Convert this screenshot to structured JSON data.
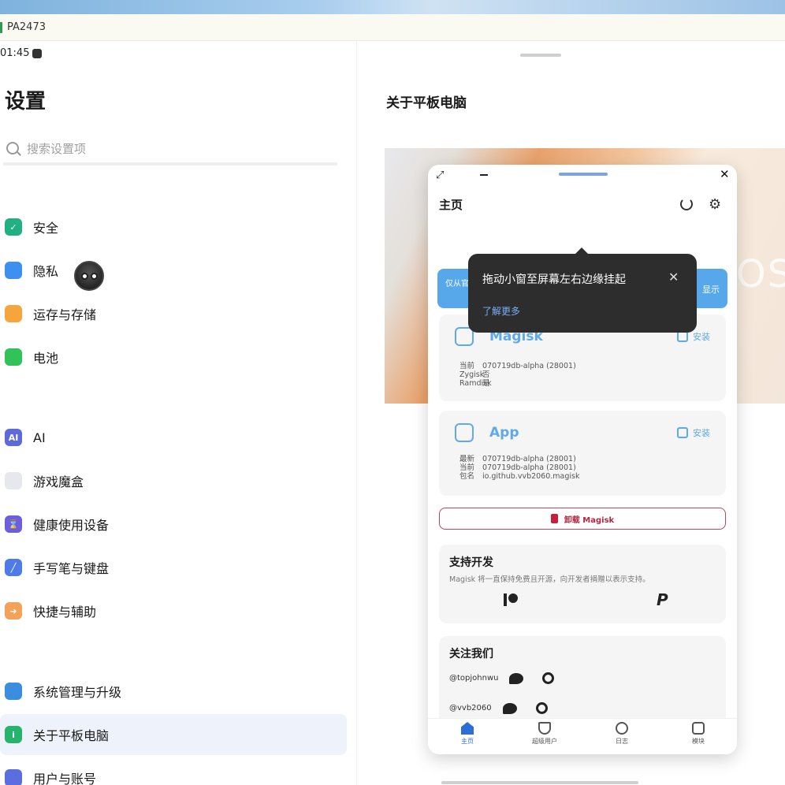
{
  "window": {
    "title": "PA2473"
  },
  "status_bar": {
    "time": "01:45"
  },
  "settings": {
    "title": "设置",
    "search_placeholder": "搜索设置项",
    "items": [
      {
        "label": "安全",
        "icon": "shield-check-icon",
        "color": "#21b07f"
      },
      {
        "label": "隐私",
        "icon": "privacy-cube-icon",
        "color": "#3d8ff0"
      },
      {
        "label": "运存与存储",
        "icon": "storage-pie-icon",
        "color": "#f5a53c"
      },
      {
        "label": "电池",
        "icon": "battery-icon",
        "color": "#31c25a"
      },
      {
        "label": "AI",
        "icon": "ai-icon",
        "color": "#5e6ad8"
      },
      {
        "label": "游戏魔盒",
        "icon": "gamepad-icon",
        "color": "#e7e7ee"
      },
      {
        "label": "健康使用设备",
        "icon": "hourglass-icon",
        "color": "#6b5fe0"
      },
      {
        "label": "手写笔与键盘",
        "icon": "stylus-icon",
        "color": "#4f7be8"
      },
      {
        "label": "快捷与辅助",
        "icon": "shortcut-arrow-icon",
        "color": "#f4a25a"
      },
      {
        "label": "系统管理与升级",
        "icon": "system-cube-icon",
        "color": "#3b8ede"
      },
      {
        "label": "关于平板电脑",
        "icon": "info-icon",
        "color": "#25b46c"
      },
      {
        "label": "用户与账号",
        "icon": "user-icon",
        "color": "#5a6ee0"
      }
    ]
  },
  "about": {
    "title": "关于平板电脑",
    "banner_text": "OS"
  },
  "magisk": {
    "app_title": "主页",
    "notice_left": "仅从官 | 需要",
    "notice_right": "显示",
    "magisk_card": {
      "name": "Magisk",
      "action": "安装",
      "rows": [
        {
          "k": "当前",
          "v": "070719db-alpha (28001)"
        },
        {
          "k": "Zygisk",
          "v": "否"
        },
        {
          "k": "Ramdisk",
          "v": "是"
        }
      ]
    },
    "app_card": {
      "name": "App",
      "action": "安装",
      "rows": [
        {
          "k": "最新",
          "v": "070719db-alpha (28001)"
        },
        {
          "k": "当前",
          "v": "070719db-alpha (28001)"
        },
        {
          "k": "包名",
          "v": "io.github.vvb2060.magisk"
        }
      ]
    },
    "uninstall_label": "卸载 Magisk",
    "support": {
      "title": "支持开发",
      "desc": "Magisk 将一直保持免费且开源，向开发者捐赠以表示支持。"
    },
    "follow": {
      "title": "关注我们",
      "accounts": [
        "@topjohnwu",
        "@vvb2060"
      ]
    },
    "nav": [
      "主页",
      "超级用户",
      "日志",
      "模块"
    ]
  },
  "tooltip": {
    "text": "拖动小窗至屏幕左右边缘挂起",
    "link": "了解更多"
  }
}
